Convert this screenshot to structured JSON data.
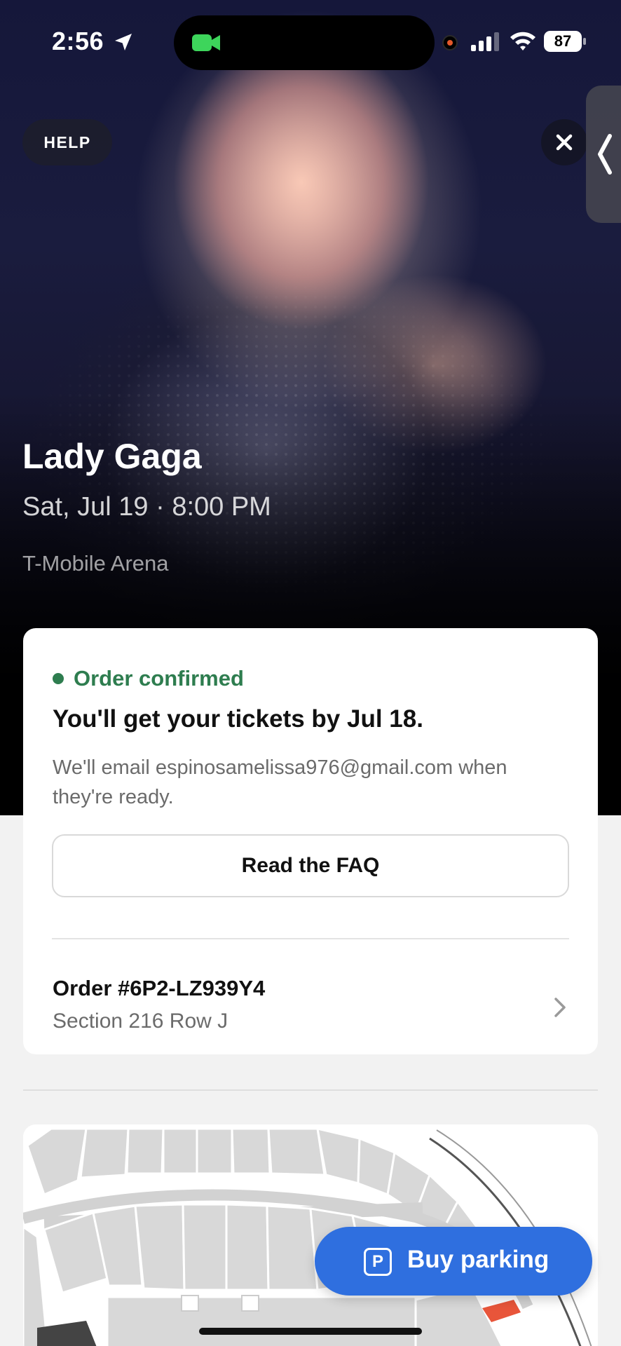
{
  "status_bar": {
    "time": "2:56",
    "battery": "87"
  },
  "hero": {
    "help_label": "HELP",
    "event_title": "Lady Gaga",
    "event_datetime": "Sat, Jul 19 · 8:00 PM",
    "venue": "T-Mobile Arena"
  },
  "order_card": {
    "status_text": "Order confirmed",
    "status_color": "#2e7d4f",
    "tickets_heading": "You'll get your tickets by Jul 18.",
    "email_note": "We'll email espinosamelissa976@gmail.com when they're ready.",
    "faq_button": "Read the FAQ",
    "order_number": "Order #6P2-LZ939Y4",
    "order_section": "Section 216 Row J"
  },
  "parking": {
    "icon_letter": "P",
    "label": "Buy parking",
    "accent": "#2f6fdf"
  }
}
